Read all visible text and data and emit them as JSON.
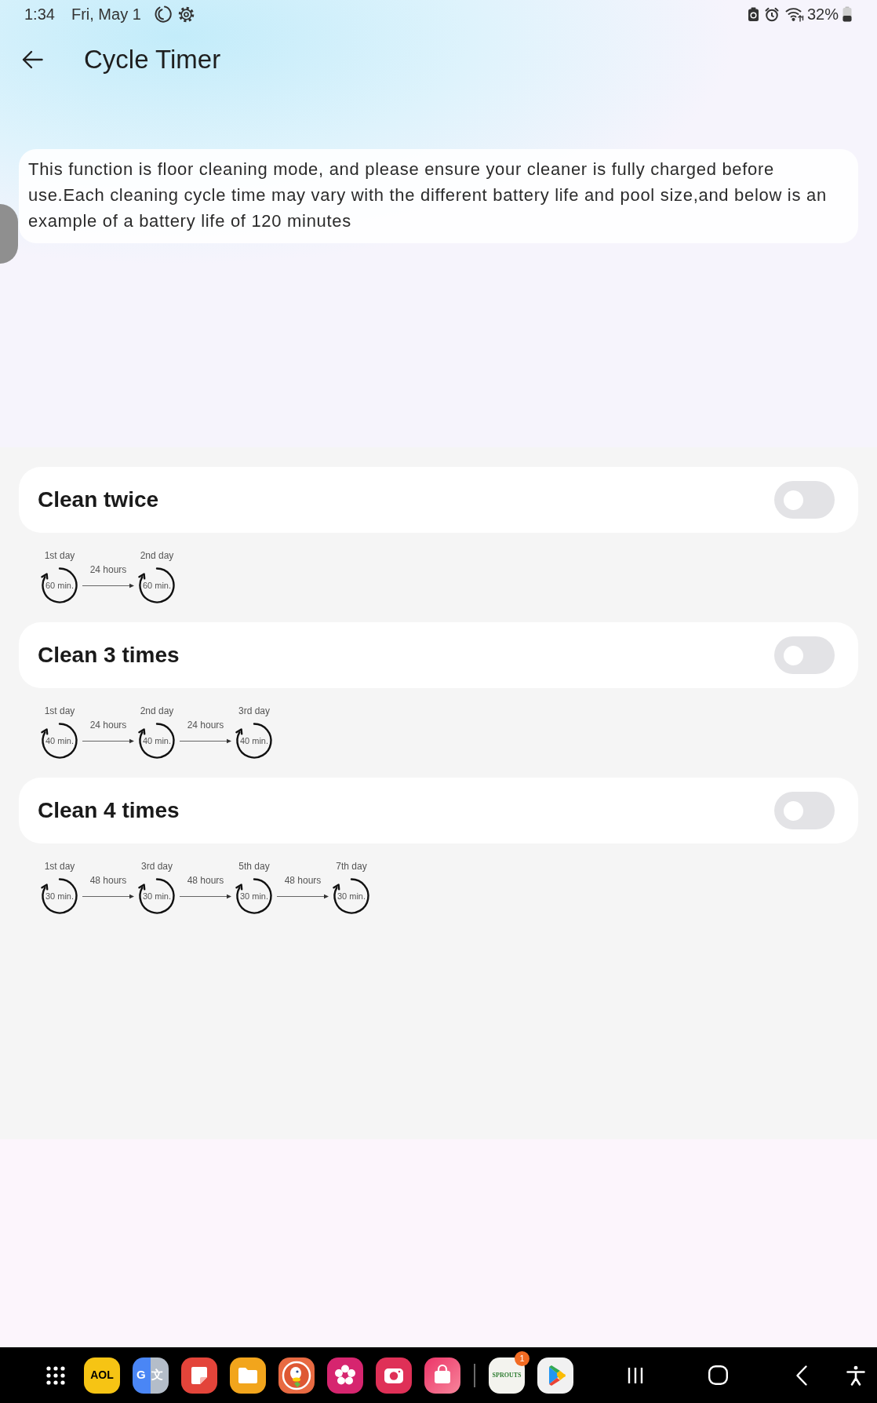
{
  "status_bar": {
    "time": "1:34",
    "date": "Fri, May 1",
    "battery_percent": "32%"
  },
  "header": {
    "title": "Cycle Timer"
  },
  "notice": {
    "text": "This function is floor cleaning mode, and please ensure your cleaner is fully charged before use.Each cleaning cycle time may vary with the different battery life and pool size,and below is an example of a battery life of 120 minutes"
  },
  "modes": [
    {
      "title": "Clean twice",
      "on": false,
      "steps": [
        {
          "day": "1st day",
          "duration": "60 min."
        },
        {
          "interval": "24 hours",
          "day": "2nd day",
          "duration": "60 min."
        }
      ]
    },
    {
      "title": "Clean 3 times",
      "on": false,
      "steps": [
        {
          "day": "1st day",
          "duration": "40 min."
        },
        {
          "interval": "24 hours",
          "day": "2nd day",
          "duration": "40 min."
        },
        {
          "interval": "24 hours",
          "day": "3rd day",
          "duration": "40 min."
        }
      ]
    },
    {
      "title": "Clean 4 times",
      "on": false,
      "steps": [
        {
          "day": "1st day",
          "duration": "30 min."
        },
        {
          "interval": "48 hours",
          "day": "3rd day",
          "duration": "30 min."
        },
        {
          "interval": "48 hours",
          "day": "5th day",
          "duration": "30 min."
        },
        {
          "interval": "48 hours",
          "day": "7th day",
          "duration": "30 min."
        }
      ]
    }
  ],
  "taskbar": {
    "apps": [
      {
        "kind": "launcher"
      },
      {
        "kind": "wordmark",
        "label": "AOL"
      },
      {
        "kind": "translate",
        "label": "G文"
      },
      {
        "kind": "notes"
      },
      {
        "kind": "folder"
      },
      {
        "kind": "duck"
      },
      {
        "kind": "flower"
      },
      {
        "kind": "camera"
      },
      {
        "kind": "bag"
      },
      {
        "kind": "divider"
      },
      {
        "kind": "store",
        "label": "SPROUTS",
        "badge": "1"
      },
      {
        "kind": "play"
      }
    ],
    "nav": [
      {
        "kind": "recents"
      },
      {
        "kind": "home"
      },
      {
        "kind": "back"
      },
      {
        "kind": "accessibility"
      }
    ]
  }
}
